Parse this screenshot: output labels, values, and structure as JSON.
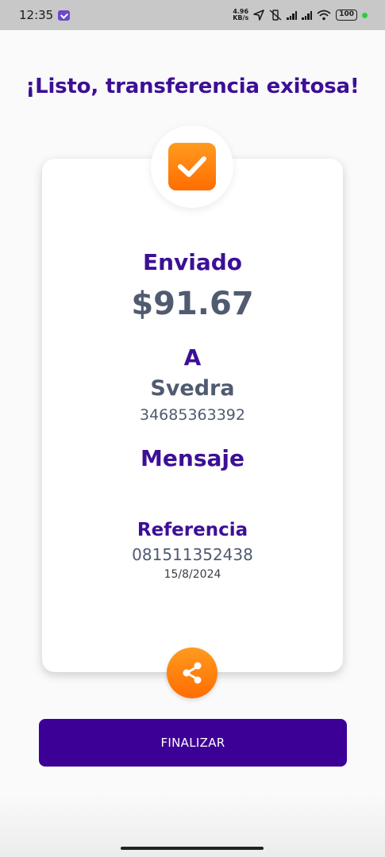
{
  "status_bar": {
    "time": "12:35",
    "speed_value": "4.96",
    "speed_unit": "KB/s",
    "battery": "100"
  },
  "title": "¡Listo, transferencia exitosa!",
  "receipt": {
    "sent_label": "Enviado",
    "amount": "$91.67",
    "to_label": "A",
    "recipient_name": "Svedra",
    "recipient_phone": "34685363392",
    "message_label": "Mensaje",
    "message_value": "",
    "reference_label": "Referencia",
    "reference_value": "081511352438",
    "date": "15/8/2024"
  },
  "actions": {
    "finish_label": "FINALIZAR"
  },
  "colors": {
    "primary_purple": "#3d0096",
    "accent_orange": "#ff7a00",
    "text_gray": "#505b70"
  },
  "icons": {
    "check": "check-icon",
    "share": "share-icon"
  }
}
